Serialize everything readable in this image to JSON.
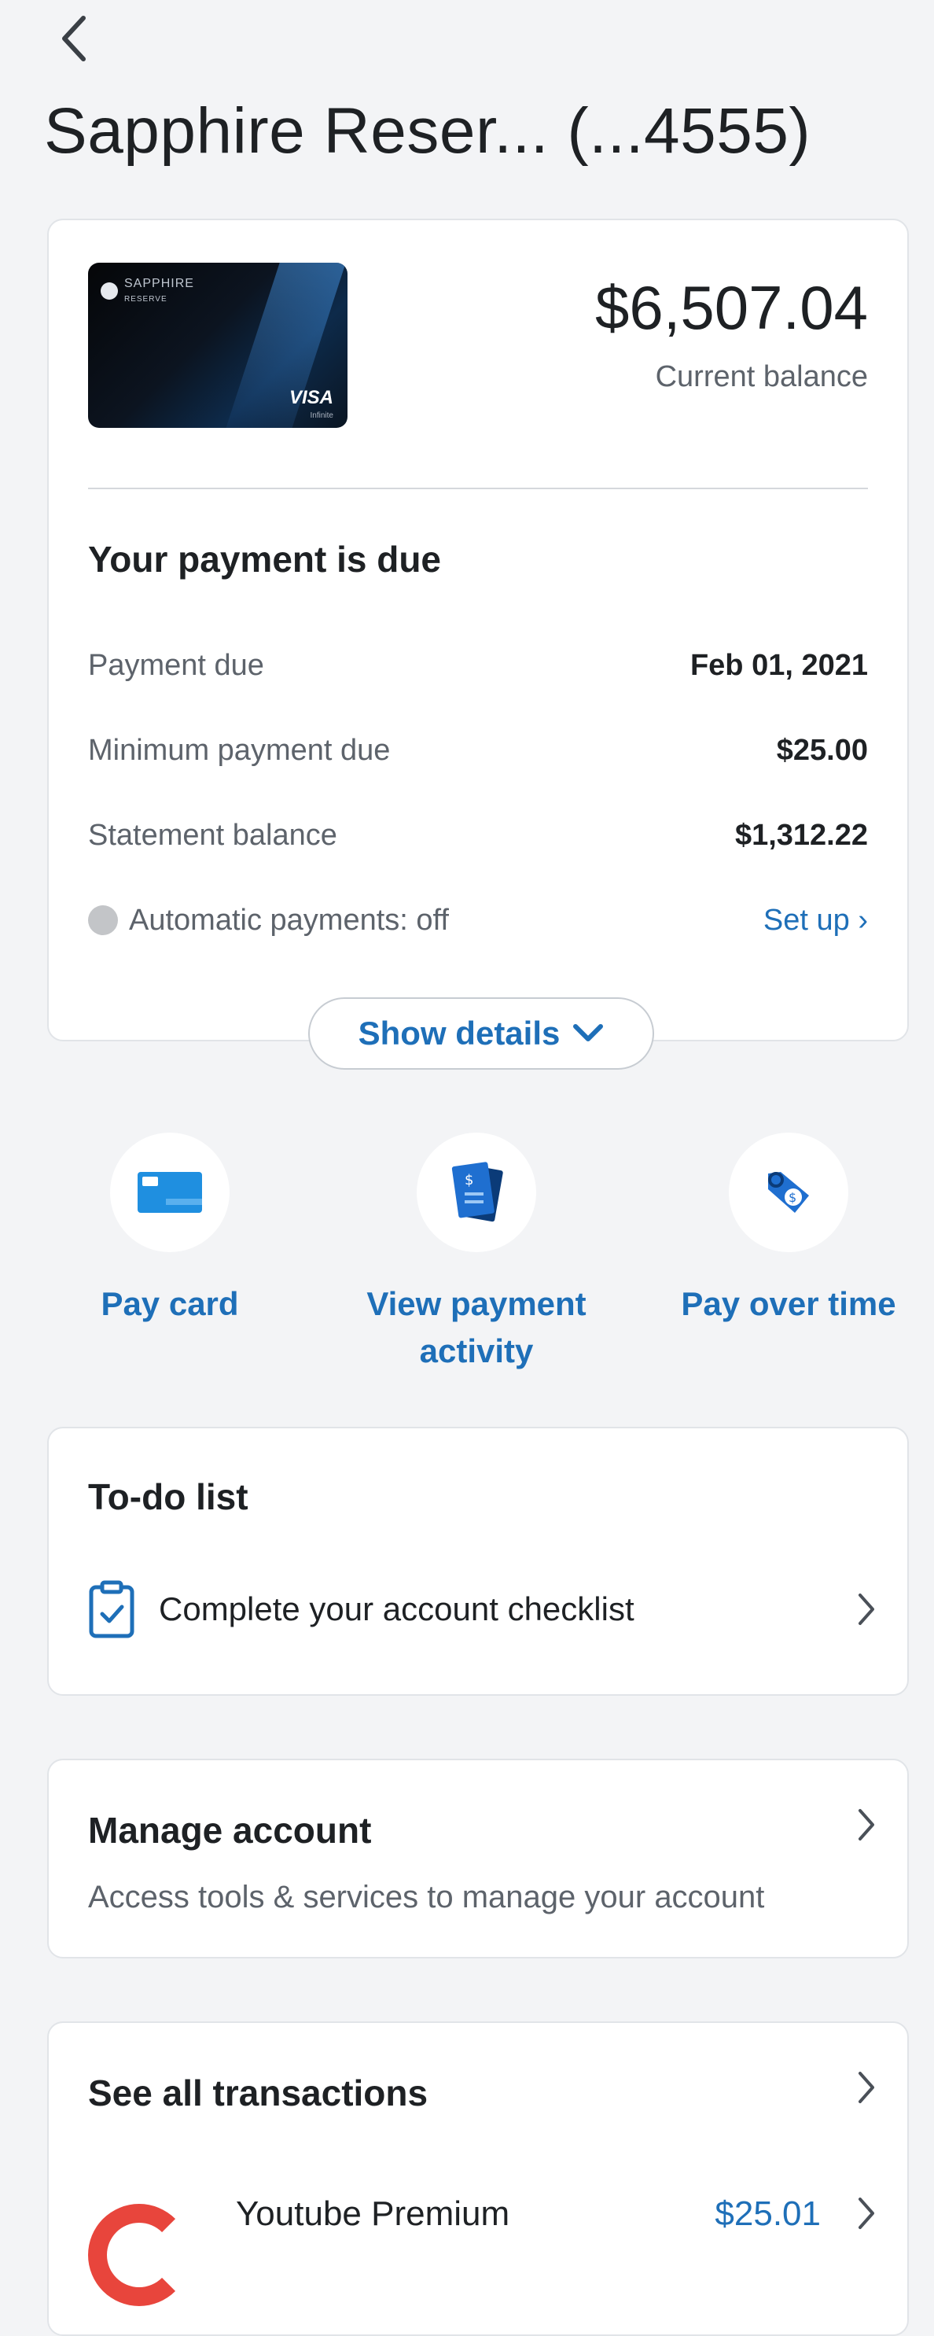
{
  "header": {
    "title": "Sapphire Reser... (...4555)"
  },
  "overview": {
    "card_brand": "SAPPHIRE",
    "card_sub": "RESERVE",
    "card_network": "VISA",
    "card_network_sub": "Infinite",
    "balance": "$6,507.04",
    "balance_label": "Current balance",
    "due_heading": "Your payment is due",
    "rows": [
      {
        "label": "Payment due",
        "value": "Feb 01, 2021"
      },
      {
        "label": "Minimum payment due",
        "value": "$25.00"
      },
      {
        "label": "Statement balance",
        "value": "$1,312.22"
      }
    ],
    "autopay_label": "Automatic payments: off",
    "setup_label": "Set up ›",
    "show_details": "Show details"
  },
  "actions": [
    {
      "label_1": "Pay card",
      "label_2": ""
    },
    {
      "label_1": "View payment",
      "label_2": "activity"
    },
    {
      "label_1": "Pay over time",
      "label_2": ""
    }
  ],
  "todo": {
    "title": "To-do list",
    "item": "Complete your account checklist"
  },
  "manage": {
    "title": "Manage account",
    "subtitle": "Access tools & services to manage your account"
  },
  "transactions": {
    "title": "See all transactions",
    "items": [
      {
        "name": "Youtube Premium",
        "amount": "$25.01"
      }
    ]
  },
  "colors": {
    "accent": "#1e6fb8",
    "background": "#f3f4f6"
  }
}
